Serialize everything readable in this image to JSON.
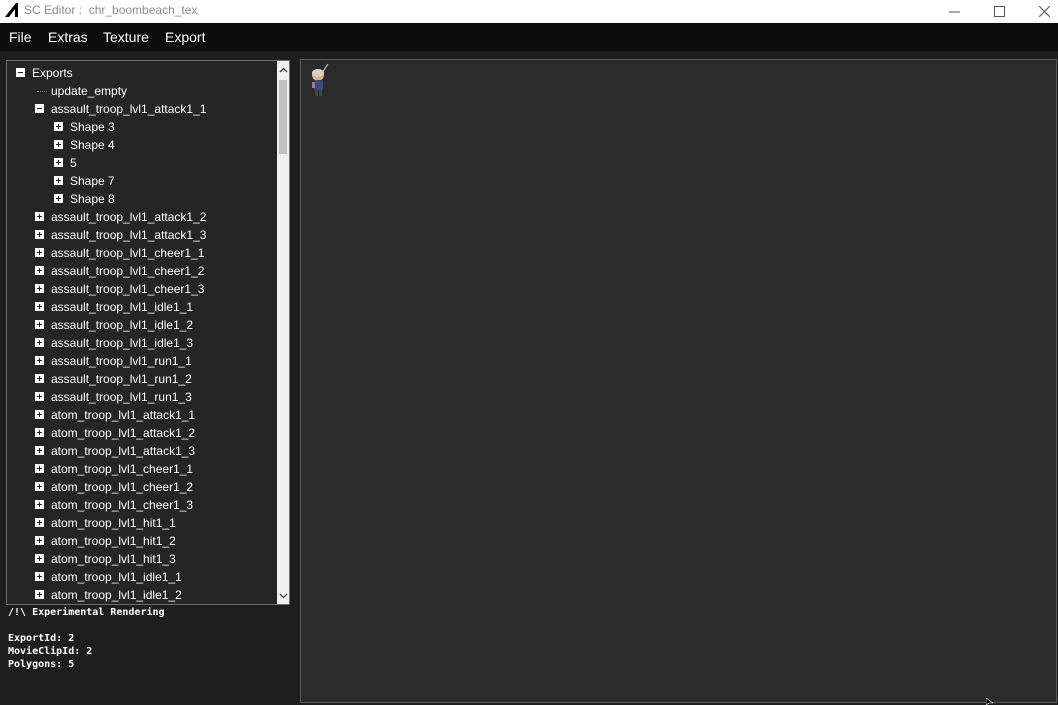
{
  "window": {
    "title": "SC Editor :  chr_boombeach_tex",
    "logo_icon": "black-triangle-logo",
    "controls": [
      "minimize-icon",
      "maximize-icon",
      "close-icon"
    ]
  },
  "menu": {
    "file": "File",
    "extras": "Extras",
    "texture": "Texture",
    "export": "Export"
  },
  "tree": {
    "items": [
      {
        "label": "Exports",
        "expander": "minus"
      },
      {
        "label": "update_empty",
        "expander": "none"
      },
      {
        "label": "assault_troop_lvl1_attack1_1",
        "expander": "minus"
      },
      {
        "label": "Shape 3",
        "expander": "plus"
      },
      {
        "label": "Shape 4",
        "expander": "plus"
      },
      {
        "label": "5",
        "expander": "plus"
      },
      {
        "label": "Shape 7",
        "expander": "plus"
      },
      {
        "label": "Shape 8",
        "expander": "plus"
      },
      {
        "label": "assault_troop_lvl1_attack1_2",
        "expander": "plus"
      },
      {
        "label": "assault_troop_lvl1_attack1_3",
        "expander": "plus"
      },
      {
        "label": "assault_troop_lvl1_cheer1_1",
        "expander": "plus"
      },
      {
        "label": "assault_troop_lvl1_cheer1_2",
        "expander": "plus"
      },
      {
        "label": "assault_troop_lvl1_cheer1_3",
        "expander": "plus"
      },
      {
        "label": "assault_troop_lvl1_idle1_1",
        "expander": "plus"
      },
      {
        "label": "assault_troop_lvl1_idle1_2",
        "expander": "plus"
      },
      {
        "label": "assault_troop_lvl1_idle1_3",
        "expander": "plus"
      },
      {
        "label": "assault_troop_lvl1_run1_1",
        "expander": "plus"
      },
      {
        "label": "assault_troop_lvl1_run1_2",
        "expander": "plus"
      },
      {
        "label": "assault_troop_lvl1_run1_3",
        "expander": "plus"
      },
      {
        "label": "atom_troop_lvl1_attack1_1",
        "expander": "plus"
      },
      {
        "label": "atom_troop_lvl1_attack1_2",
        "expander": "plus"
      },
      {
        "label": "atom_troop_lvl1_attack1_3",
        "expander": "plus"
      },
      {
        "label": "atom_troop_lvl1_cheer1_1",
        "expander": "plus"
      },
      {
        "label": "atom_troop_lvl1_cheer1_2",
        "expander": "plus"
      },
      {
        "label": "atom_troop_lvl1_cheer1_3",
        "expander": "plus"
      },
      {
        "label": "atom_troop_lvl1_hit1_1",
        "expander": "plus"
      },
      {
        "label": "atom_troop_lvl1_hit1_2",
        "expander": "plus"
      },
      {
        "label": "atom_troop_lvl1_hit1_3",
        "expander": "plus"
      },
      {
        "label": "atom_troop_lvl1_idle1_1",
        "expander": "plus"
      },
      {
        "label": "atom_troop_lvl1_idle1_2",
        "expander": "plus"
      }
    ]
  },
  "info": {
    "warning": "/!\\ Experimental Rendering",
    "export_id": "ExportId: 2",
    "movieclip_id": "MovieClipId: 2",
    "polygons": "Polygons: 5"
  },
  "canvas": {
    "sprite_icon": "troop-sprite-preview"
  },
  "colors": {
    "menu_bg": "#0d0d0d",
    "panel_bg": "#252525",
    "canvas_bg": "#2b2b2b",
    "text": "#ffffff"
  }
}
